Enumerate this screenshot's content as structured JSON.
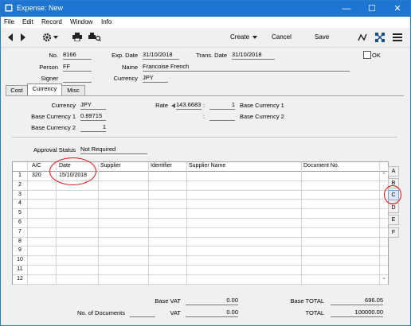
{
  "window": {
    "title": "Expense: New"
  },
  "menu": [
    "File",
    "Edit",
    "Record",
    "Window",
    "Info"
  ],
  "toolbar": {
    "create": "Create",
    "cancel": "Cancel",
    "save": "Save"
  },
  "header": {
    "no_label": "No.",
    "no_value": "8166",
    "exp_date_label": "Exp. Date",
    "exp_date_value": "31/10/2018",
    "trans_date_label": "Trans. Date",
    "trans_date_value": "31/10/2018",
    "ok_label": "OK",
    "person_label": "Person",
    "person_value": "FF",
    "name_label": "Name",
    "name_value": "Francoise French",
    "signer_label": "Signer",
    "signer_value": "",
    "currency_label": "Currency",
    "currency_value": "JPY"
  },
  "tabs": [
    "Cost",
    "Currency",
    "Misc"
  ],
  "active_tab": "Currency",
  "currency_panel": {
    "currency_label": "Currency",
    "currency_value": "JPY",
    "rate_label": "Rate",
    "rate_value": "143.6683",
    "rate_sep": ":",
    "rate_rhs": "1",
    "rate_rhs_label": "Base Currency 1",
    "base1_label": "Base Currency 1",
    "base1_value": "0.89715",
    "base1_sep": ":",
    "base1_rhs": "",
    "base1_rhs_label": "Base Currency 2",
    "base2_label": "Base Currency 2",
    "base2_value": "1"
  },
  "approval": {
    "label": "Approval Status",
    "value": "Not Required"
  },
  "grid": {
    "columns": [
      "A/C",
      "Date",
      "Supplier",
      "Identifier",
      "Supplier Name",
      "Document No."
    ],
    "row_numbers": [
      "1",
      "2",
      "3",
      "4",
      "5",
      "6",
      "7",
      "8",
      "9",
      "10",
      "11",
      "12"
    ],
    "rows": [
      {
        "ac": "320",
        "date": "15/10/2018",
        "supplier": "",
        "identifier": "",
        "supplier_name": "",
        "document_no": ""
      }
    ],
    "side_tabs": [
      "A",
      "B",
      "C",
      "D",
      "E",
      "F"
    ],
    "active_side_tab": "C"
  },
  "footer": {
    "base_vat_label": "Base VAT",
    "base_vat_value": "0.00",
    "base_total_label": "Base TOTAL",
    "base_total_value": "696.05",
    "num_docs_label": "No. of Documents",
    "num_docs_value": "",
    "vat_label": "VAT",
    "vat_value": "0.00",
    "total_label": "TOTAL",
    "total_value": "100000.00"
  },
  "colors": {
    "titlebar": "#1c76d2",
    "annotation": "#e01010"
  },
  "icons": [
    "app-icon",
    "minimize-icon",
    "maximize-icon",
    "close-icon",
    "prev-record-icon",
    "next-record-icon",
    "settings-gear-icon",
    "print-icon",
    "print-preview-icon",
    "chevron-down-icon",
    "function-icon",
    "expand-icon",
    "list-icon"
  ]
}
